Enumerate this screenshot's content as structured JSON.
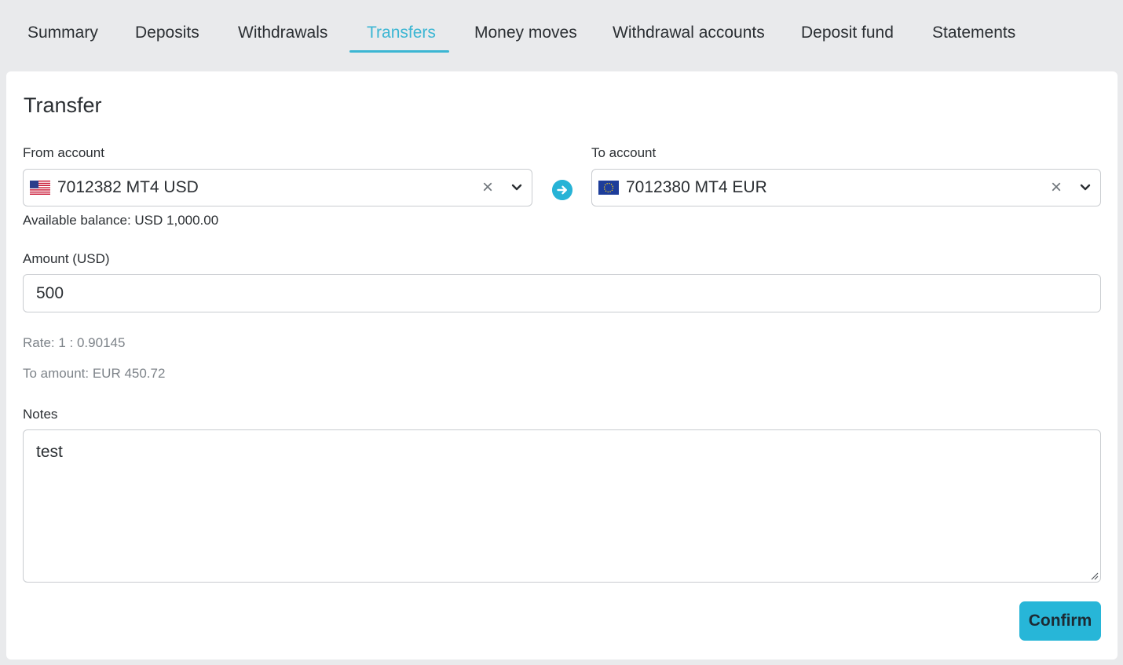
{
  "tabs": [
    {
      "label": "Summary"
    },
    {
      "label": "Deposits"
    },
    {
      "label": "Withdrawals"
    },
    {
      "label": "Transfers"
    },
    {
      "label": "Money moves"
    },
    {
      "label": "Withdrawal accounts"
    },
    {
      "label": "Deposit fund"
    },
    {
      "label": "Statements"
    }
  ],
  "active_tab": "Transfers",
  "colors": {
    "accent": "#3bb6d3",
    "button": "#27b6d8",
    "background": "#e9eaec"
  },
  "form": {
    "title": "Transfer",
    "from_label": "From account",
    "from_value": "7012382 MT4 USD",
    "from_flag": "us-flag-icon",
    "balance": "Available balance: USD 1,000.00",
    "to_label": "To account",
    "to_value": "7012380 MT4 EUR",
    "to_flag": "eu-flag-icon",
    "amount_label": "Amount  (USD)",
    "amount_value": "500",
    "rate": "Rate: 1 : 0.90145",
    "to_amount": "To amount: EUR 450.72",
    "notes_label": "Notes",
    "notes_value": "test",
    "confirm_label": "Confirm"
  }
}
